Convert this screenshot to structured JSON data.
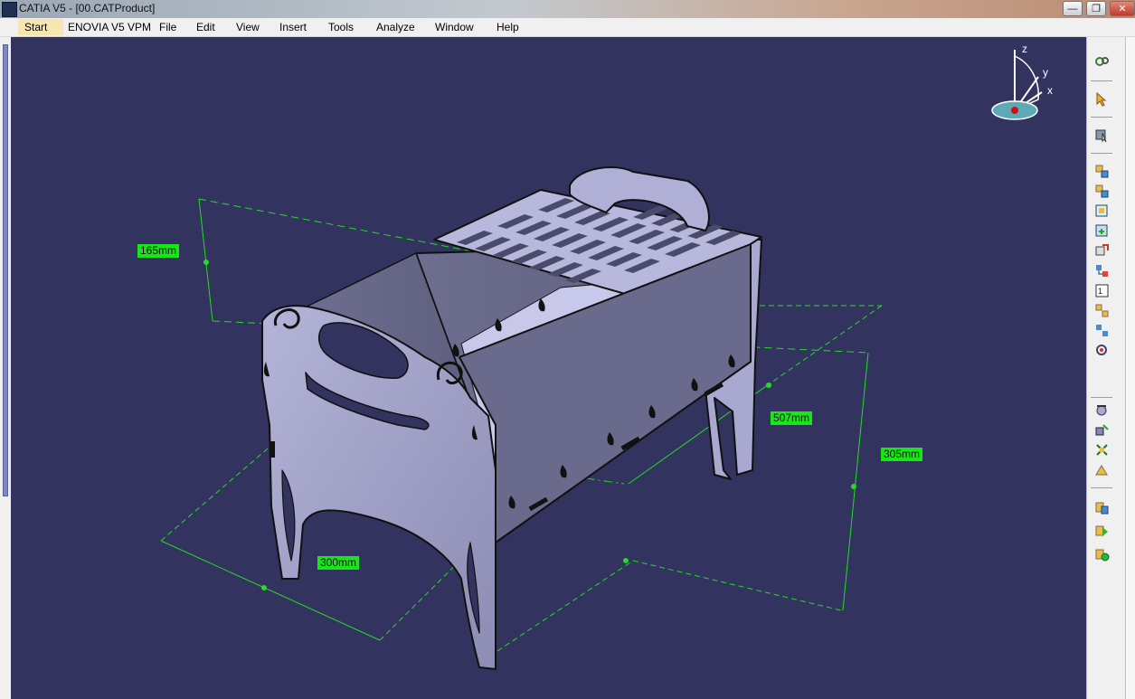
{
  "window": {
    "title": "CATIA V5 - [00.CATProduct]",
    "controls": {
      "minimize": "—",
      "restore": "❐",
      "close": "✕"
    }
  },
  "menubar": {
    "items": [
      "Start",
      "ENOVIA V5 VPM",
      "File",
      "Edit",
      "View",
      "Insert",
      "Tools",
      "Analyze",
      "Window",
      "Help"
    ]
  },
  "compass": {
    "z": "z",
    "y": "y",
    "x": "x"
  },
  "dimensions": {
    "height_left": "165mm",
    "length": "507mm",
    "height_right": "305mm",
    "width": "300mm"
  },
  "toolbar_icons": [
    "sketcher-icon",
    "select-icon",
    "deselect-icon",
    "product-structure-icon",
    "insert-component-icon",
    "new-product-icon",
    "existing-component-icon",
    "replace-component-icon",
    "graph-tree-icon",
    "generate-numbering-icon",
    "multi-instantiation-icon",
    "fast-multi-instantiation-icon",
    "reuse-pattern-icon",
    "manipulation-icon",
    "snap-icon",
    "explode-icon",
    "stop-manipulate-icon",
    "coincidence-constraint-icon",
    "contact-constraint-icon",
    "offset-constraint-icon"
  ],
  "colors": {
    "viewport_bg": "#33335f",
    "part_face": "#9898c0",
    "dimension_green": "#19e619",
    "menu_bg": "#f0f0f0"
  }
}
